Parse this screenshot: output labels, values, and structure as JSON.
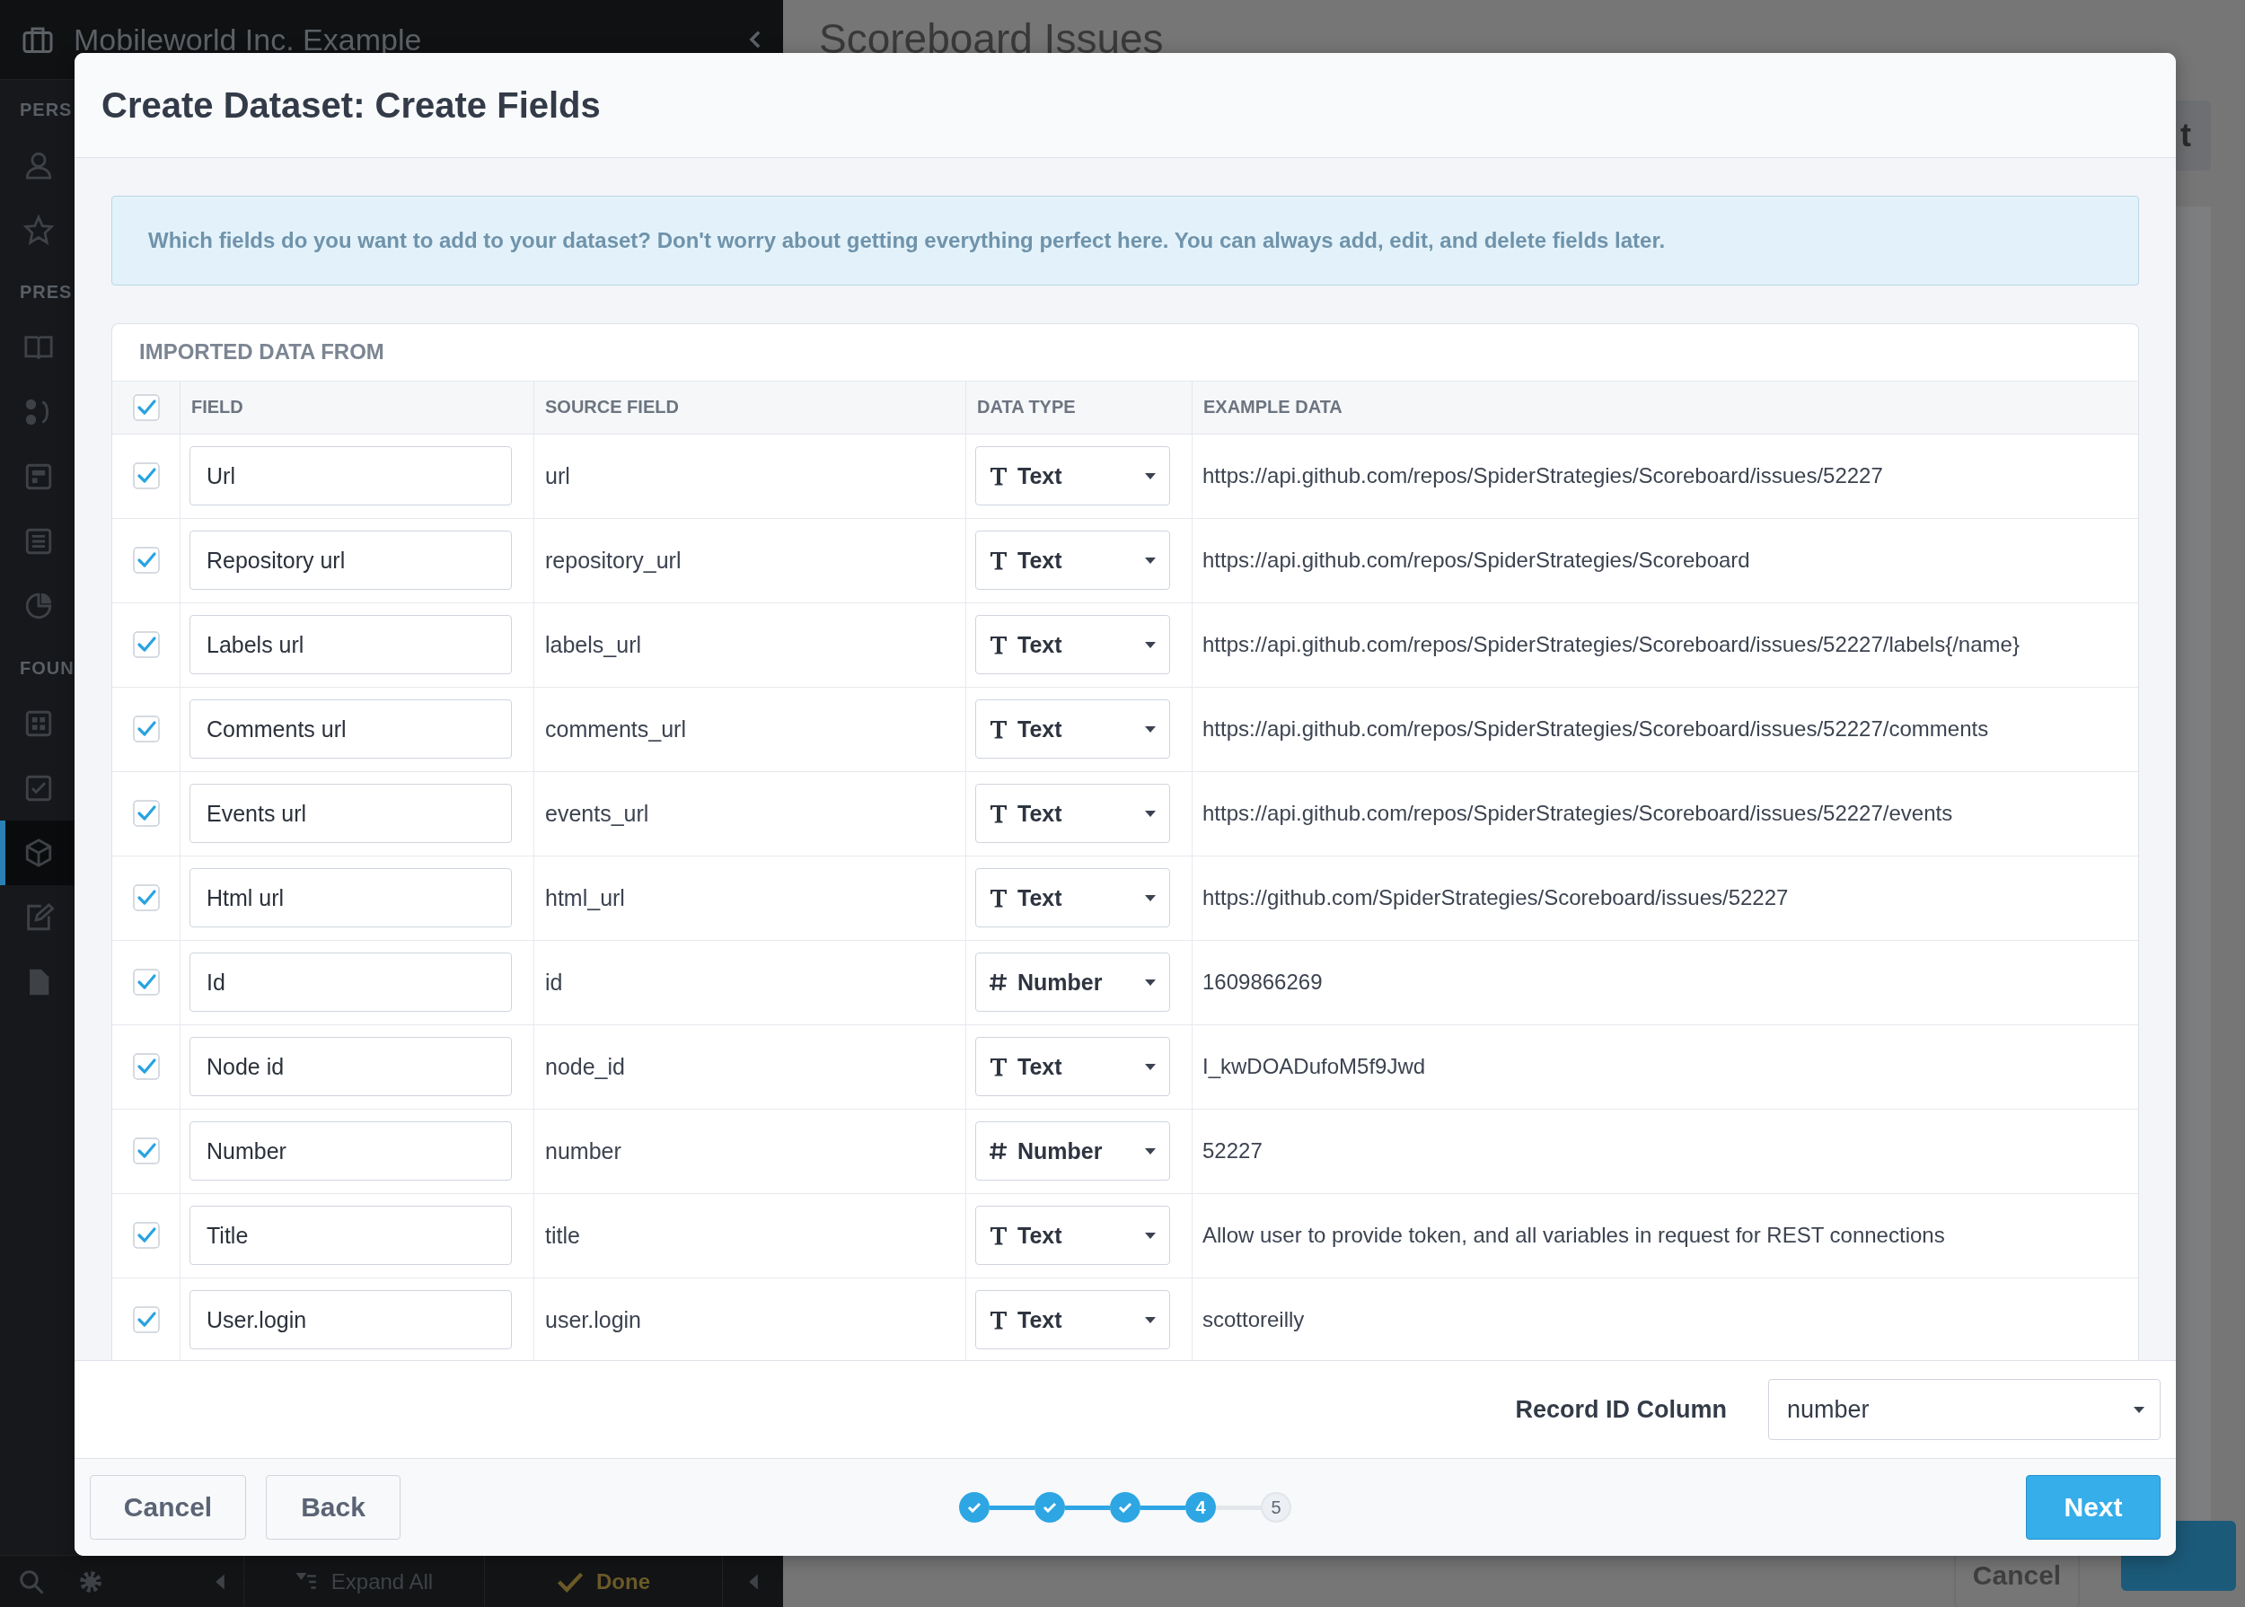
{
  "background": {
    "org_name": "Mobileworld Inc. Example",
    "page_title": "Scoreboard Issues",
    "page_action": "t",
    "page_cancel": "Cancel",
    "sidebar_sections": [
      {
        "label": "PERS",
        "items": [
          {
            "selected": false
          },
          {
            "selected": false
          }
        ]
      },
      {
        "label": "PRES",
        "items": [
          {
            "selected": false
          },
          {
            "selected": false
          },
          {
            "selected": false
          },
          {
            "selected": false
          },
          {
            "selected": false
          }
        ]
      },
      {
        "label": "FOUN",
        "items": [
          {
            "selected": false
          },
          {
            "selected": false
          },
          {
            "selected": true
          },
          {
            "selected": false
          },
          {
            "selected": false
          }
        ]
      }
    ],
    "bottom_bar": {
      "expand_all": "Expand All",
      "done": "Done"
    }
  },
  "dialog": {
    "title": "Create Dataset: Create Fields",
    "info": "Which fields do you want to add to your dataset? Don't worry about getting everything perfect here. You can always add, edit, and delete fields later.",
    "table": {
      "caption": "IMPORTED DATA FROM",
      "all_checked": true,
      "columns": [
        "FIELD",
        "SOURCE FIELD",
        "DATA TYPE",
        "EXAMPLE DATA"
      ],
      "rows": [
        {
          "checked": true,
          "field": "Url",
          "source_field": "url",
          "data_type": {
            "kind": "text",
            "label": "Text"
          },
          "example": "https://api.github.com/repos/SpiderStrategies/Scoreboard/issues/52227"
        },
        {
          "checked": true,
          "field": "Repository url",
          "source_field": "repository_url",
          "data_type": {
            "kind": "text",
            "label": "Text"
          },
          "example": "https://api.github.com/repos/SpiderStrategies/Scoreboard"
        },
        {
          "checked": true,
          "field": "Labels url",
          "source_field": "labels_url",
          "data_type": {
            "kind": "text",
            "label": "Text"
          },
          "example": "https://api.github.com/repos/SpiderStrategies/Scoreboard/issues/52227/labels{/name}"
        },
        {
          "checked": true,
          "field": "Comments url",
          "source_field": "comments_url",
          "data_type": {
            "kind": "text",
            "label": "Text"
          },
          "example": "https://api.github.com/repos/SpiderStrategies/Scoreboard/issues/52227/comments"
        },
        {
          "checked": true,
          "field": "Events url",
          "source_field": "events_url",
          "data_type": {
            "kind": "text",
            "label": "Text"
          },
          "example": "https://api.github.com/repos/SpiderStrategies/Scoreboard/issues/52227/events"
        },
        {
          "checked": true,
          "field": "Html url",
          "source_field": "html_url",
          "data_type": {
            "kind": "text",
            "label": "Text"
          },
          "example": "https://github.com/SpiderStrategies/Scoreboard/issues/52227"
        },
        {
          "checked": true,
          "field": "Id",
          "source_field": "id",
          "data_type": {
            "kind": "number",
            "label": "Number"
          },
          "example": "1609866269"
        },
        {
          "checked": true,
          "field": "Node id",
          "source_field": "node_id",
          "data_type": {
            "kind": "text",
            "label": "Text"
          },
          "example": "I_kwDOADufoM5f9Jwd"
        },
        {
          "checked": true,
          "field": "Number",
          "source_field": "number",
          "data_type": {
            "kind": "number",
            "label": "Number"
          },
          "example": "52227"
        },
        {
          "checked": true,
          "field": "Title",
          "source_field": "title",
          "data_type": {
            "kind": "text",
            "label": "Text"
          },
          "example": "Allow user to provide token, and all variables in request for REST connections"
        },
        {
          "checked": true,
          "field": "User.login",
          "source_field": "user.login",
          "data_type": {
            "kind": "text",
            "label": "Text"
          },
          "example": "scottoreilly"
        }
      ]
    },
    "record_id": {
      "label": "Record ID Column",
      "value": "number"
    },
    "buttons": {
      "cancel": "Cancel",
      "back": "Back",
      "next": "Next"
    },
    "steps": [
      {
        "kind": "done"
      },
      {
        "kind": "done"
      },
      {
        "kind": "done"
      },
      {
        "kind": "current",
        "label": "4"
      },
      {
        "kind": "upcoming",
        "label": "5"
      }
    ]
  }
}
